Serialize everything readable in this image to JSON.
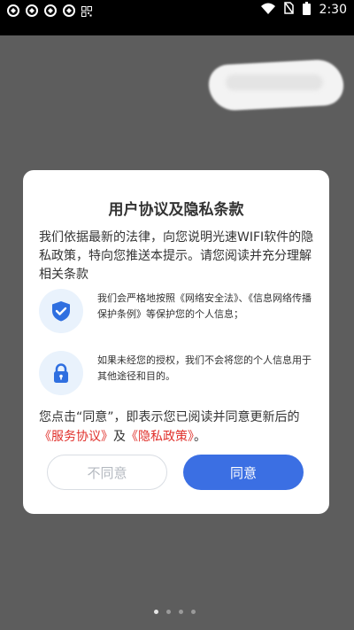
{
  "status_bar": {
    "time": "2:30",
    "left_icons": [
      "notification-icon",
      "notification-icon",
      "notification-icon",
      "notification-icon",
      "qr-icon"
    ],
    "right_icons": [
      "wifi-icon",
      "no-sim-icon",
      "battery-icon"
    ]
  },
  "dialog": {
    "title": "用户协议及隐私条款",
    "intro": "我们依据最新的法律，向您说明光速WIFI软件的隐私政策，特向您推送本提示。请您阅读并充分理解相关条款",
    "items": [
      {
        "icon": "shield-check-icon",
        "text": "我们会严格地按照《网络安全法》、《信息网络传播保护条例》等保护您的个人信息；"
      },
      {
        "icon": "lock-icon",
        "text": "如果未经您的授权，我们不会将您的个人信息用于其他途径和目的。"
      }
    ],
    "notice": {
      "prefix": "您点击“同意”，即表示您已阅读并同意更新后的",
      "link1": "《服务协议》",
      "middle": "及",
      "link2": "《隐私政策》",
      "suffix": "。"
    },
    "disagree_label": "不同意",
    "agree_label": "同意"
  },
  "page_indicator": {
    "count": 4,
    "active": 0
  },
  "colors": {
    "accent": "#3b6fe3",
    "link": "#e0302b",
    "overlay": "#5d5d5d",
    "icon_bg": "#e9f2fc"
  }
}
